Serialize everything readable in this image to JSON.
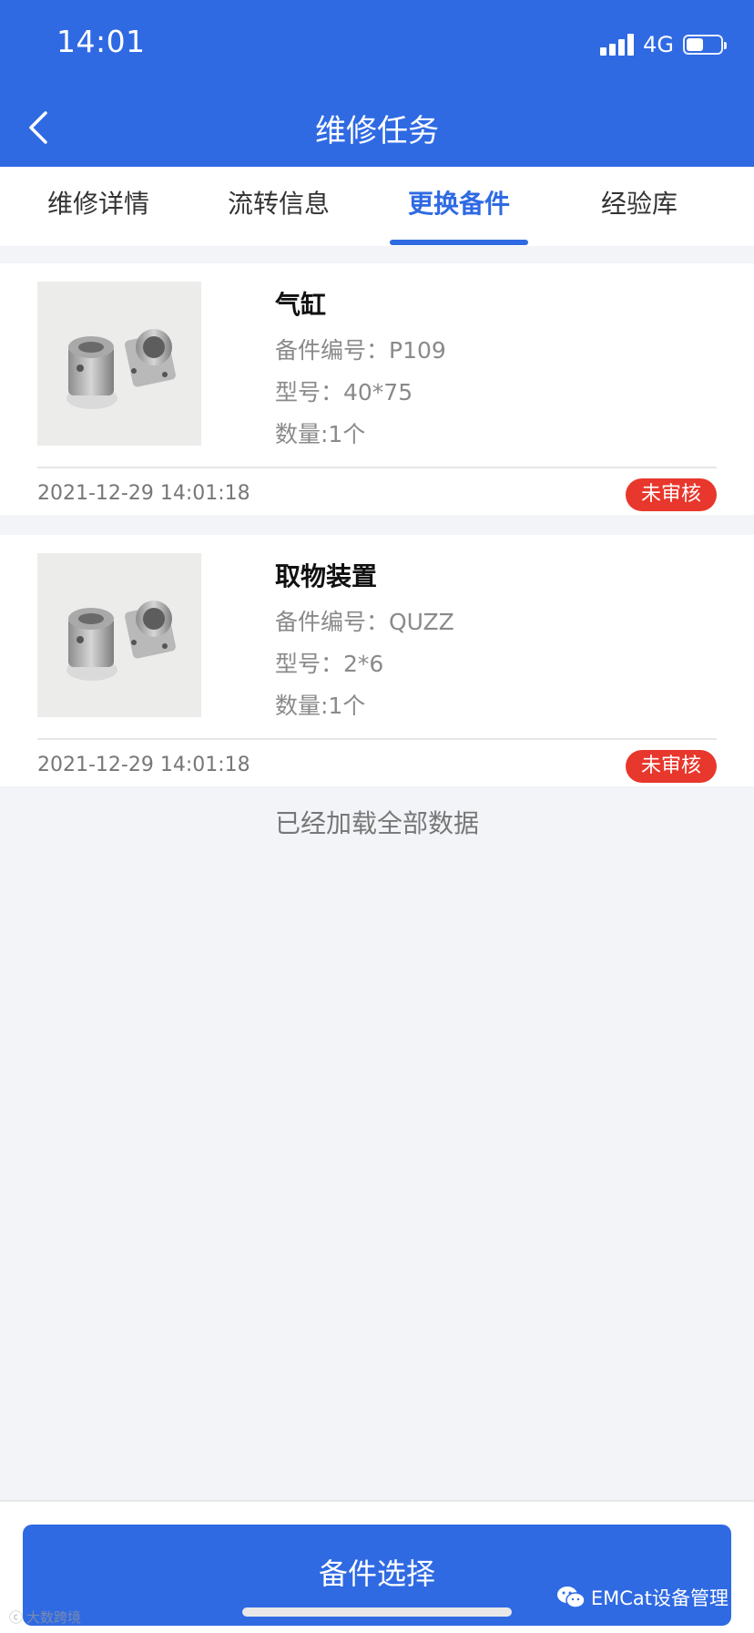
{
  "status_bar": {
    "time": "14:01",
    "network": "4G"
  },
  "header": {
    "title": "维修任务"
  },
  "tabs": [
    {
      "label": "维修详情"
    },
    {
      "label": "流转信息"
    },
    {
      "label": "更换备件",
      "active": true
    },
    {
      "label": "经验库"
    }
  ],
  "parts": [
    {
      "name": "气缸",
      "code": "备件编号：P109",
      "model": "型号：40*75",
      "qty": "数量:1个",
      "date": "2021-12-29 14:01:18",
      "status": "未审核"
    },
    {
      "name": "取物装置",
      "code": "备件编号：QUZZ",
      "model": "型号：2*6",
      "qty": "数量:1个",
      "date": "2021-12-29 14:01:18",
      "status": "未审核"
    }
  ],
  "loaded_text": "已经加载全部数据",
  "bottom": {
    "button_label": "备件选择"
  },
  "watermark": {
    "right": "EMCat设备管理",
    "left": "大数跨境"
  },
  "colors": {
    "primary": "#2f6ae3",
    "badge": "#e8372c",
    "background": "#f2f4f8"
  }
}
